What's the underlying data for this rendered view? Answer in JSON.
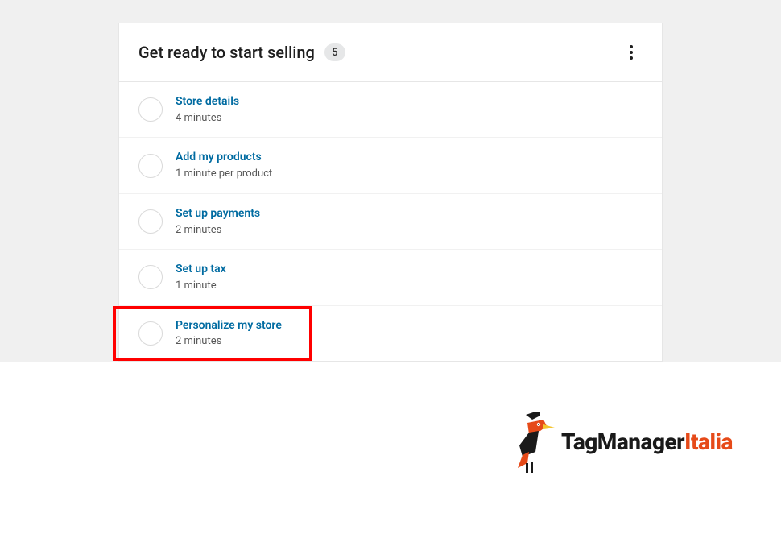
{
  "header": {
    "title": "Get ready to start selling",
    "count": "5"
  },
  "tasks": [
    {
      "title": "Store details",
      "time": "4 minutes"
    },
    {
      "title": "Add my products",
      "time": "1 minute per product"
    },
    {
      "title": "Set up payments",
      "time": "2 minutes"
    },
    {
      "title": "Set up tax",
      "time": "1 minute"
    },
    {
      "title": "Personalize my store",
      "time": "2 minutes"
    }
  ],
  "brand": {
    "part1": "TagManager",
    "part2": "Italia"
  },
  "colors": {
    "link": "#006ba1",
    "accent": "#e64a19",
    "highlight": "#ff0000"
  }
}
